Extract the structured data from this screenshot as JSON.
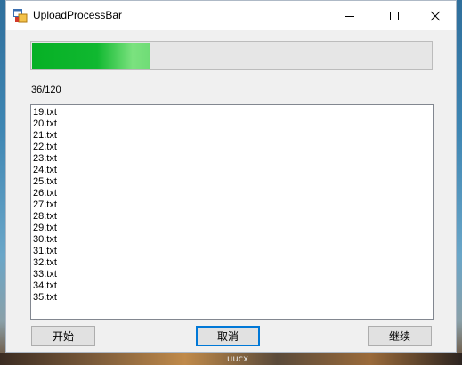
{
  "window": {
    "title": "UploadProcessBar",
    "icon": "app-window-icon"
  },
  "titlebar_buttons": [
    "minimize-icon",
    "maximize-icon",
    "close-icon"
  ],
  "progress": {
    "fraction": 0.3,
    "fill_color": "#06b025",
    "label": "36/120"
  },
  "file_list": {
    "items": [
      "19.txt",
      "20.txt",
      "21.txt",
      "22.txt",
      "23.txt",
      "24.txt",
      "25.txt",
      "26.txt",
      "27.txt",
      "28.txt",
      "29.txt",
      "30.txt",
      "31.txt",
      "32.txt",
      "33.txt",
      "34.txt",
      "35.txt"
    ]
  },
  "buttons": {
    "start": "开始",
    "cancel": "取消",
    "continue": "继续"
  },
  "desktop": {
    "taskbar_text": "uucx"
  }
}
